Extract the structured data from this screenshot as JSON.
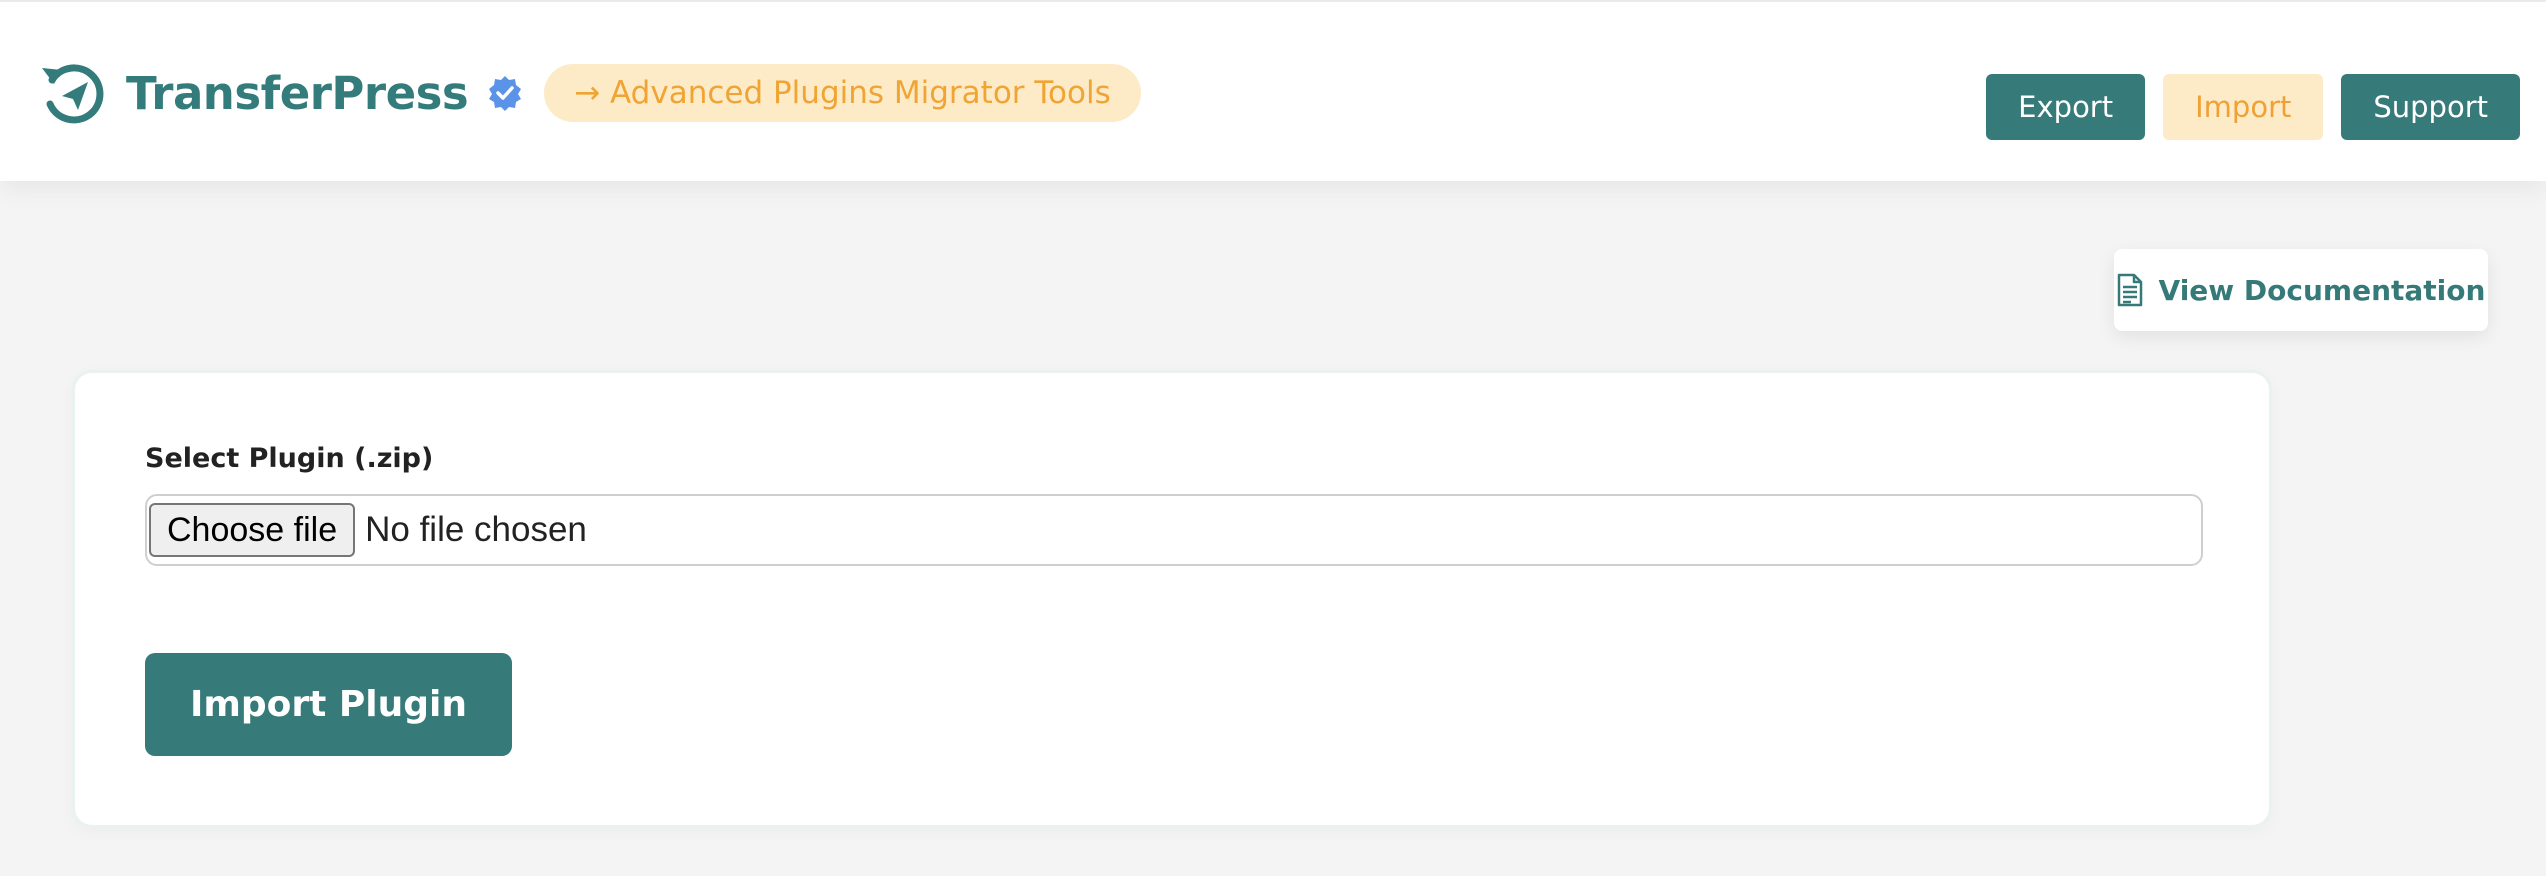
{
  "header": {
    "brand_name": "TransferPress",
    "tagline": "→ Advanced Plugins Migrator Tools",
    "logo_icon": "refresh-send-icon",
    "verified_icon": "verified-badge-icon",
    "nav": [
      {
        "label": "Export",
        "active": false
      },
      {
        "label": "Import",
        "active": true
      },
      {
        "label": "Support",
        "active": false
      }
    ]
  },
  "docs": {
    "label": "View Documentation",
    "icon": "document-icon"
  },
  "form": {
    "field_label": "Select Plugin (.zip)",
    "choose_file_label": "Choose file",
    "file_status": "No file chosen",
    "submit_label": "Import Plugin"
  },
  "colors": {
    "primary": "#367b7a",
    "accent_bg": "#fdebc8",
    "accent_text": "#f0a434",
    "verified": "#5b93e8"
  }
}
